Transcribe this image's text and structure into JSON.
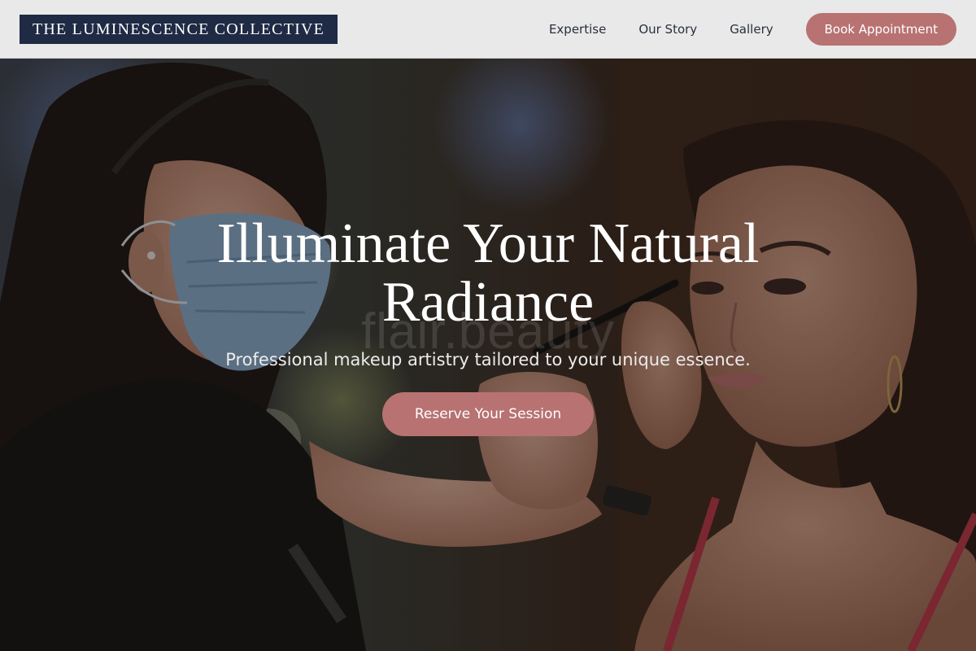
{
  "header": {
    "logo_text": "THE LUMINESCENCE COLLECTIVE",
    "nav": [
      {
        "label": "Expertise"
      },
      {
        "label": "Our Story"
      },
      {
        "label": "Gallery"
      }
    ],
    "book_button_label": "Book Appointment"
  },
  "hero": {
    "image_description": "makeup-artist-applying-eyeliner-to-client",
    "watermark_text": "flair.beauty",
    "title_line1": "Illuminate Your Natural",
    "title_line2": "Radiance",
    "subtitle": "Professional makeup artistry tailored to your unique essence.",
    "cta_label": "Reserve Your Session"
  },
  "colors": {
    "header_bg": "#e9e9e9",
    "logo_bg": "#1f2a44",
    "accent": "#b87272",
    "text_dark": "#2a2f3f",
    "hero_text": "#ffffff"
  }
}
